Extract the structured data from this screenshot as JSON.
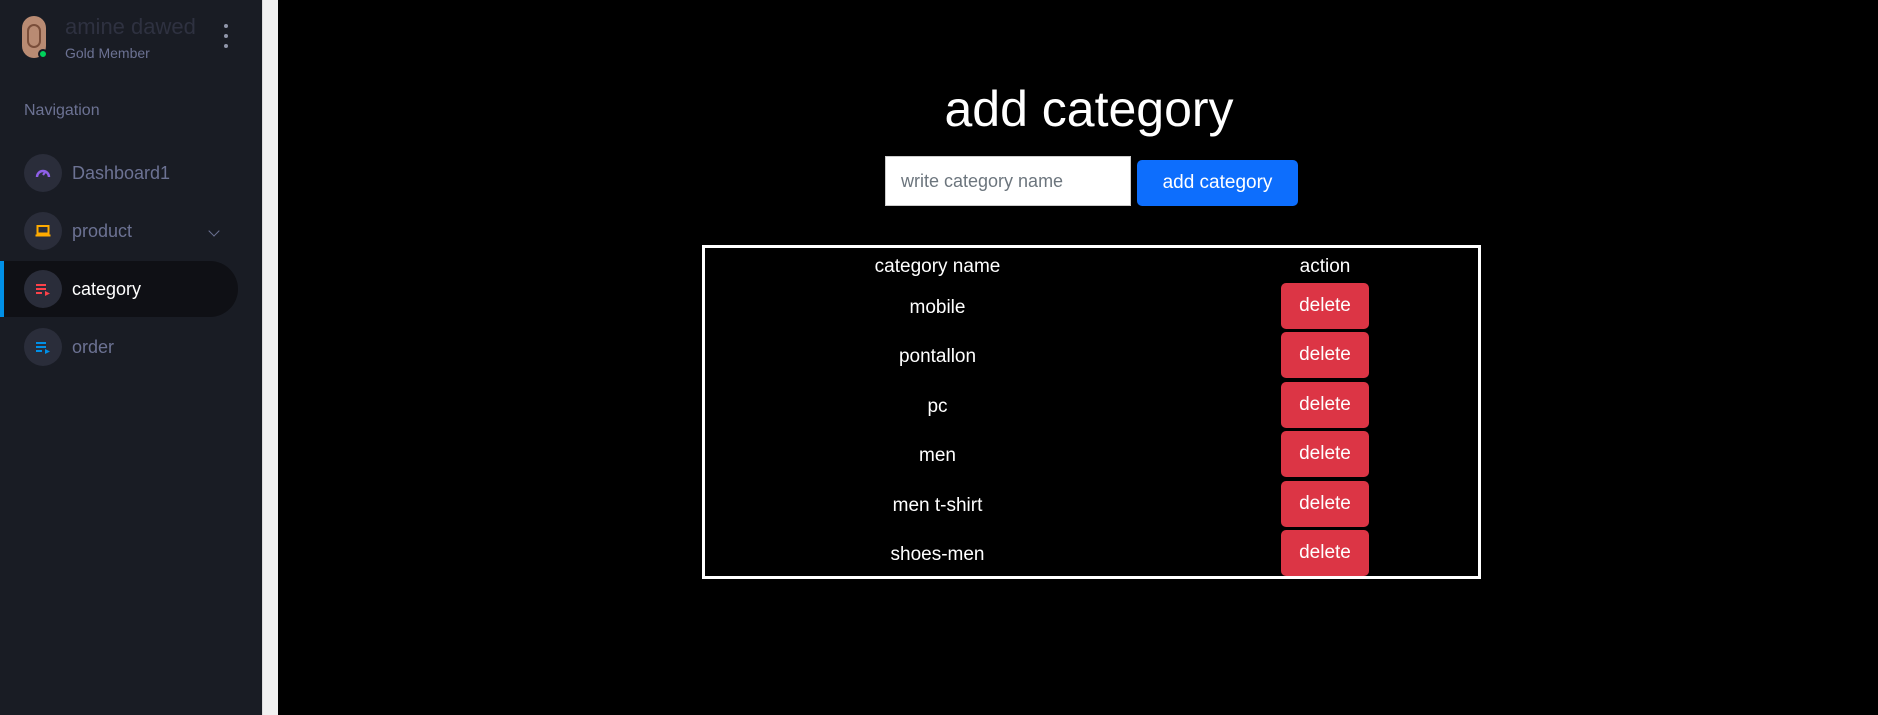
{
  "sidebar": {
    "profile": {
      "name": "amine dawed",
      "role": "Gold Member"
    },
    "nav_heading": "Navigation",
    "items": [
      {
        "label": "Dashboard1",
        "icon": "speedometer-icon",
        "color": "#8f5fe8"
      },
      {
        "label": "product",
        "icon": "laptop-icon",
        "color": "#ffab00"
      },
      {
        "label": "category",
        "icon": "playlist-play-icon",
        "color": "#fc424a",
        "active": true
      },
      {
        "label": "order",
        "icon": "playlist-play-icon",
        "color": "#0090e7"
      }
    ]
  },
  "main": {
    "title": "add category",
    "input": {
      "placeholder": "write category name",
      "value": ""
    },
    "add_button": "add category",
    "table": {
      "headers": [
        "category name",
        "action"
      ],
      "rows": [
        {
          "name": "mobile",
          "action": "delete"
        },
        {
          "name": "pontallon",
          "action": "delete"
        },
        {
          "name": "pc",
          "action": "delete"
        },
        {
          "name": "men",
          "action": "delete"
        },
        {
          "name": "men t-shirt",
          "action": "delete"
        },
        {
          "name": "shoes-men",
          "action": "delete"
        }
      ]
    }
  },
  "colors": {
    "sidebar_bg": "#191c24",
    "page_bg": "#000000",
    "primary": "#0d6efd",
    "danger": "#dc3545",
    "active_indicator": "#0090e7"
  }
}
